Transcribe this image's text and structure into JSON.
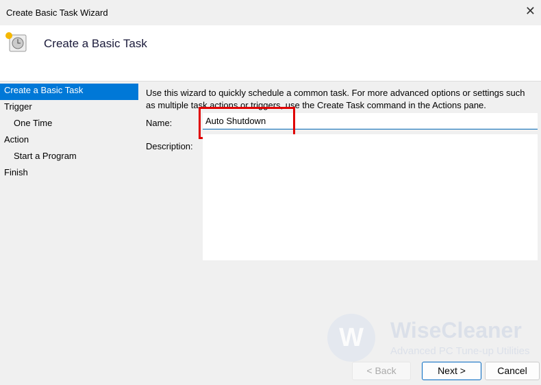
{
  "window": {
    "title": "Create Basic Task Wizard"
  },
  "header": {
    "title": "Create a Basic Task",
    "icon": "task-scheduler-icon"
  },
  "nav": {
    "items": [
      {
        "label": "Create a Basic Task",
        "selected": true
      },
      {
        "label": "Trigger"
      },
      {
        "label": "One Time",
        "sub": true
      },
      {
        "label": "Action"
      },
      {
        "label": "Start a Program",
        "sub": true
      },
      {
        "label": "Finish"
      }
    ]
  },
  "main": {
    "intro": "Use this wizard to quickly schedule a common task.  For more advanced options or settings such as multiple task actions or triggers, use the Create Task command in the Actions pane.",
    "name_label": "Name:",
    "name_value": "Auto Shutdown",
    "description_label": "Description:",
    "description_value": ""
  },
  "watermark": {
    "brand": "WiseCleaner",
    "tagline": "Advanced PC Tune-up Utilities",
    "letter": "W"
  },
  "buttons": {
    "back": "< Back",
    "next": "Next >",
    "cancel": "Cancel"
  },
  "colors": {
    "selection": "#0078d7",
    "highlight": "#e00000"
  }
}
